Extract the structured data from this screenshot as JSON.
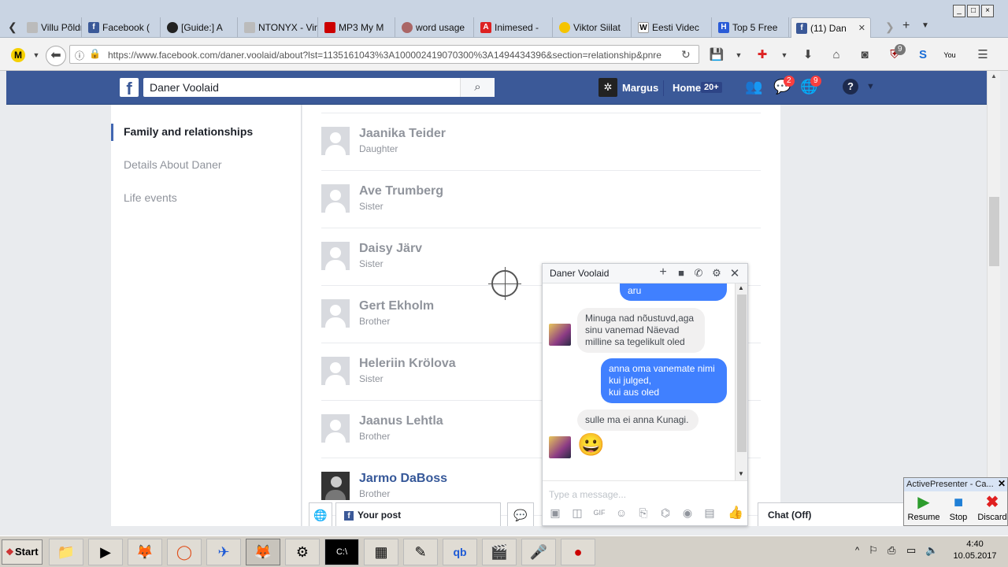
{
  "browser": {
    "tabs": [
      {
        "label": "Villu Põldm",
        "icon": "page-icon"
      },
      {
        "label": "Facebook (",
        "icon": "facebook-icon"
      },
      {
        "label": "[Guide:] A",
        "icon": "github-icon"
      },
      {
        "label": "NTONYX - Virtu",
        "icon": "page-icon"
      },
      {
        "label": "MP3 My M",
        "icon": "mp3-icon"
      },
      {
        "label": "word usage",
        "icon": "link-icon"
      },
      {
        "label": "Inimesed -",
        "icon": "letter-a-icon"
      },
      {
        "label": "Viktor Siilat",
        "icon": "circle-icon"
      },
      {
        "label": "Eesti Videc",
        "icon": "wikipedia-icon"
      },
      {
        "label": "Top 5 Free",
        "icon": "letter-h-icon"
      },
      {
        "label": "(11) Dan",
        "icon": "facebook-icon",
        "active": true
      }
    ],
    "url": "https://www.facebook.com/daner.voolaid/about?lst=1135161043%3A100002419070300%3A1494434396&section=relationship&pnre",
    "window_controls": [
      "_",
      "□",
      "×"
    ]
  },
  "facebook": {
    "search_value": "Daner Voolaid",
    "user_name": "Margus",
    "home_label": "Home",
    "home_badge": "20+",
    "messages_badge": "2",
    "notifications_badge": "9"
  },
  "left_nav": {
    "items": [
      {
        "label": "Family and relationships",
        "active": true
      },
      {
        "label": "Details About Daner"
      },
      {
        "label": "Life events"
      }
    ]
  },
  "family_members": [
    {
      "name": "Jaanika Teider",
      "relation": "Daughter"
    },
    {
      "name": "Ave Trumberg",
      "relation": "Sister"
    },
    {
      "name": "Daisy Järv",
      "relation": "Sister"
    },
    {
      "name": "Gert Ekholm",
      "relation": "Brother"
    },
    {
      "name": "Heleriin Krölova",
      "relation": "Sister"
    },
    {
      "name": "Jaanus Lehtla",
      "relation": "Brother"
    },
    {
      "name": "Jarmo DaBoss",
      "relation": "Brother",
      "linked": true
    }
  ],
  "chat": {
    "title": "Daner Voolaid",
    "messages": [
      {
        "from": "me",
        "text": "aru"
      },
      {
        "from": "them",
        "text": "Minuga nad nõustuvd,aga\nsinu vanemad Näevad\nmilline sa tegelikult oled"
      },
      {
        "from": "me",
        "text": "anna oma vanemate nimi\nkui julged,\nkui aus oled"
      },
      {
        "from": "them",
        "text": "sulle ma ei anna Kunagi."
      },
      {
        "from": "them",
        "text": "😀"
      }
    ],
    "input_placeholder": "Type a message..."
  },
  "dock": {
    "your_post_label": "Your post",
    "chat_status": "Chat (Off)"
  },
  "active_presenter": {
    "title": "ActivePresenter - Ca...",
    "buttons": [
      "Resume",
      "Stop",
      "Discard"
    ]
  },
  "taskbar": {
    "start_label": "Start",
    "time": "4:40",
    "date": "10.05.2017"
  },
  "colors": {
    "facebook_blue": "#3b5998",
    "messenger_blue": "#4080ff",
    "link_blue": "#365899"
  }
}
